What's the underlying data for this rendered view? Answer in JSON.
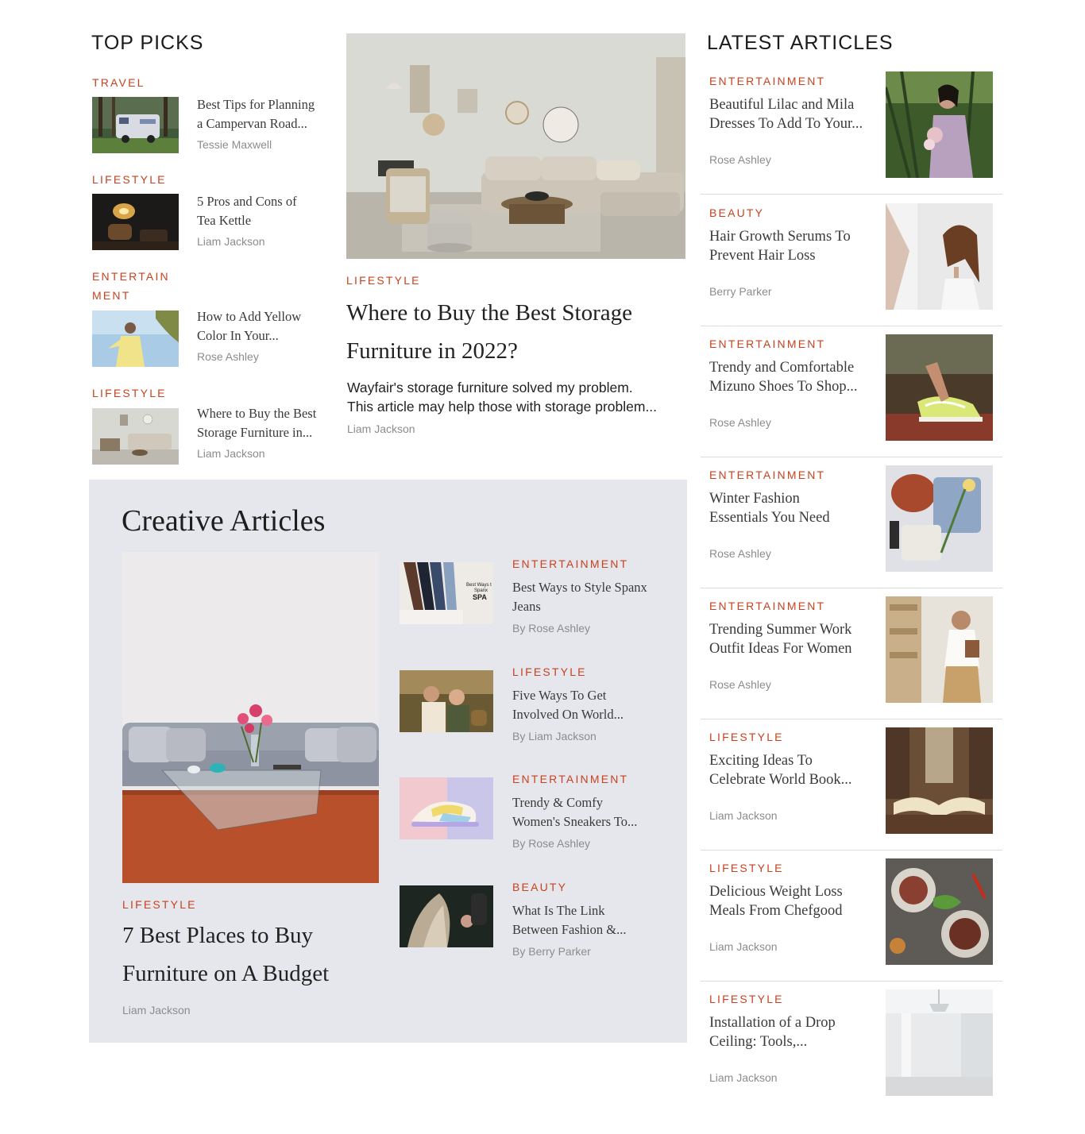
{
  "top_picks": {
    "heading": "TOP PICKS",
    "items": [
      {
        "category": "TRAVEL",
        "title_l1": "Best Tips for Planning",
        "title_l2": "a Campervan Road...",
        "author": "Tessie Maxwell"
      },
      {
        "category": "LIFESTYLE",
        "title_l1": "5 Pros and Cons of",
        "title_l2": "Tea Kettle",
        "author": "Liam Jackson"
      },
      {
        "category_l1": "ENTERTAIN",
        "category_l2": "MENT",
        "title_l1": "How to Add Yellow",
        "title_l2": "Color In Your...",
        "author": "Rose Ashley"
      },
      {
        "category": "LIFESTYLE",
        "title_l1": "Where to Buy the Best",
        "title_l2": "Storage Furniture in...",
        "author": "Liam Jackson"
      }
    ]
  },
  "featured": {
    "category": "LIFESTYLE",
    "title_l1": "Where to Buy the Best Storage",
    "title_l2": "Furniture in 2022?",
    "excerpt_l1": "Wayfair's storage furniture solved my problem.",
    "excerpt_l2": "This article may help those with storage problem...",
    "author": "Liam Jackson"
  },
  "creative": {
    "heading": "Creative Articles",
    "main": {
      "category": "LIFESTYLE",
      "title_l1": "7 Best Places to Buy",
      "title_l2": "Furniture on A Budget",
      "author": "Liam Jackson"
    },
    "items": [
      {
        "category": "ENTERTAINMENT",
        "title_l1": "Best Ways to Style Spanx",
        "title_l2": "Jeans",
        "author": "By Rose Ashley",
        "thumb_text_l1": "Best Ways t",
        "thumb_text_l2": "Spanx",
        "thumb_text_l3": "SPA"
      },
      {
        "category": "LIFESTYLE",
        "title_l1": "Five Ways To Get",
        "title_l2": "Involved On World...",
        "author": "By Liam Jackson"
      },
      {
        "category": "ENTERTAINMENT",
        "title_l1": "Trendy & Comfy",
        "title_l2": "Women's Sneakers To...",
        "author": "By Rose Ashley"
      },
      {
        "category": "BEAUTY",
        "title_l1": "What Is The Link",
        "title_l2": "Between Fashion &...",
        "author": "By Berry Parker"
      }
    ]
  },
  "latest": {
    "heading": "LATEST ARTICLES",
    "items": [
      {
        "category": "ENTERTAINMENT",
        "title_l1": "Beautiful Lilac and Mila",
        "title_l2": "Dresses To Add To Your...",
        "author": "Rose Ashley"
      },
      {
        "category": "BEAUTY",
        "title_l1": " Hair Growth Serums To",
        "title_l2": "Prevent Hair Loss",
        "author": "Berry Parker"
      },
      {
        "category": "ENTERTAINMENT",
        "title_l1": "Trendy and Comfortable",
        "title_l2": "Mizuno Shoes To Shop...",
        "author": "Rose Ashley"
      },
      {
        "category": "ENTERTAINMENT",
        "title_l1": "Winter Fashion",
        "title_l2": "Essentials You Need",
        "author": "Rose Ashley"
      },
      {
        "category": "ENTERTAINMENT",
        "title_l1": "Trending Summer Work",
        "title_l2": "Outfit Ideas For Women",
        "author": "Rose Ashley"
      },
      {
        "category": "LIFESTYLE",
        "title_l1": "Exciting Ideas To",
        "title_l2": "Celebrate World Book...",
        "author": "Liam Jackson"
      },
      {
        "category": "LIFESTYLE",
        "title_l1": "Delicious Weight Loss",
        "title_l2": "Meals From Chefgood",
        "author": "Liam Jackson"
      },
      {
        "category": "LIFESTYLE",
        "title_l1": "Installation of a Drop",
        "title_l2": "Ceiling: Tools,...",
        "author": "Liam Jackson"
      }
    ]
  },
  "colors": {
    "accent": "#c8421f",
    "panel": "#e6e7ec",
    "muted": "#8c8c8c"
  }
}
